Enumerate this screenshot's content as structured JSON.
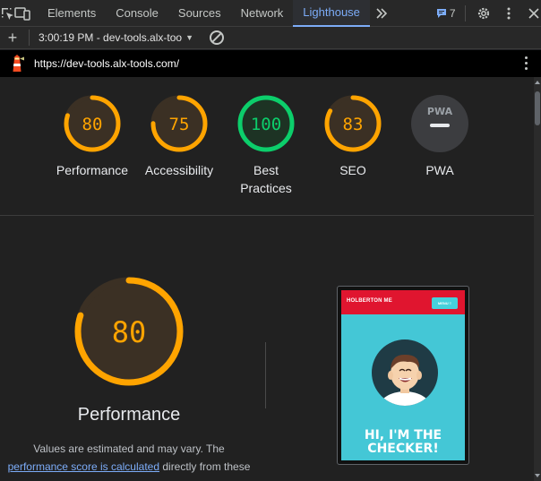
{
  "devtools": {
    "tabs": [
      {
        "label": "Elements"
      },
      {
        "label": "Console"
      },
      {
        "label": "Sources"
      },
      {
        "label": "Network"
      },
      {
        "label": "Lighthouse"
      }
    ],
    "issues_count": "7"
  },
  "toolbar": {
    "plus_label": "+",
    "report_label": "3:00:19 PM - dev-tools.alx-too"
  },
  "urlbar": {
    "url": "https://dev-tools.alx-tools.com/"
  },
  "colors": {
    "average": "#ffa400",
    "pass": "#0cce6b",
    "pwa": "#e8eaed"
  },
  "gauges": [
    {
      "label": "Performance",
      "score": "80",
      "value": 80,
      "status": "average"
    },
    {
      "label": "Accessibility",
      "score": "75",
      "value": 75,
      "status": "average"
    },
    {
      "label_line1": "Best",
      "label_line2": "Practices",
      "score": "100",
      "value": 100,
      "status": "pass"
    },
    {
      "label": "SEO",
      "score": "83",
      "value": 83,
      "status": "average"
    },
    {
      "label": "PWA",
      "badge": "PWA",
      "status": "na"
    }
  ],
  "performance": {
    "score": "80",
    "value": 80,
    "title": "Performance",
    "desc_line1": "Values are estimated and may vary. The",
    "desc_link": "performance score is calculated",
    "desc_after_link": " directly from these"
  },
  "thumbnail": {
    "brand": "HOLBERTON ME",
    "menu_label": "MENU ≡",
    "hero_line1": "HI, I'M THE",
    "hero_line2": "CHECKER!"
  }
}
